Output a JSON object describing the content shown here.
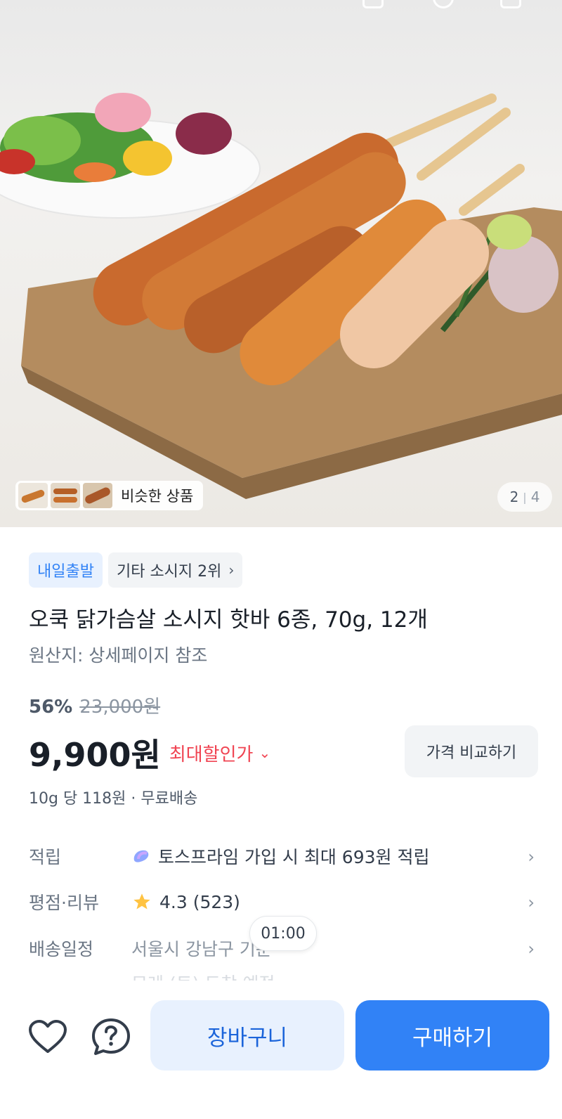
{
  "product": {
    "image_index": "2",
    "image_total": "4",
    "similar_label": "비슷한 상품",
    "badges": {
      "delivery": "내일출발",
      "ranking": "기타 소시지 2위"
    },
    "title": "오쿡 닭가슴살 소시지 핫바 6종, 70g, 12개",
    "origin": "원산지: 상세페이지 참조",
    "discount_rate": "56%",
    "original_price": "23,000원",
    "price": "9,900원",
    "max_discount_label": "최대할인가",
    "compare_label": "가격 비교하기",
    "unit_info": "10g 당 118원 · 무료배송"
  },
  "info_rows": {
    "points_key": "적립",
    "points_value": "토스프라임 가입 시 최대 693원 적립",
    "rating_key": "평점·리뷰",
    "rating_value": "4.3 (523)",
    "delivery_key": "배송일정",
    "delivery_value": "서울시 강남구 기준",
    "delivery_sub": "모레 (토) 도착 예정"
  },
  "timer": "01:00",
  "actions": {
    "cart_label": "장바구니",
    "buy_label": "구매하기"
  },
  "colors": {
    "accent_blue": "#3182f6",
    "sale_red": "#f04452",
    "star_yellow": "#ffc342"
  }
}
